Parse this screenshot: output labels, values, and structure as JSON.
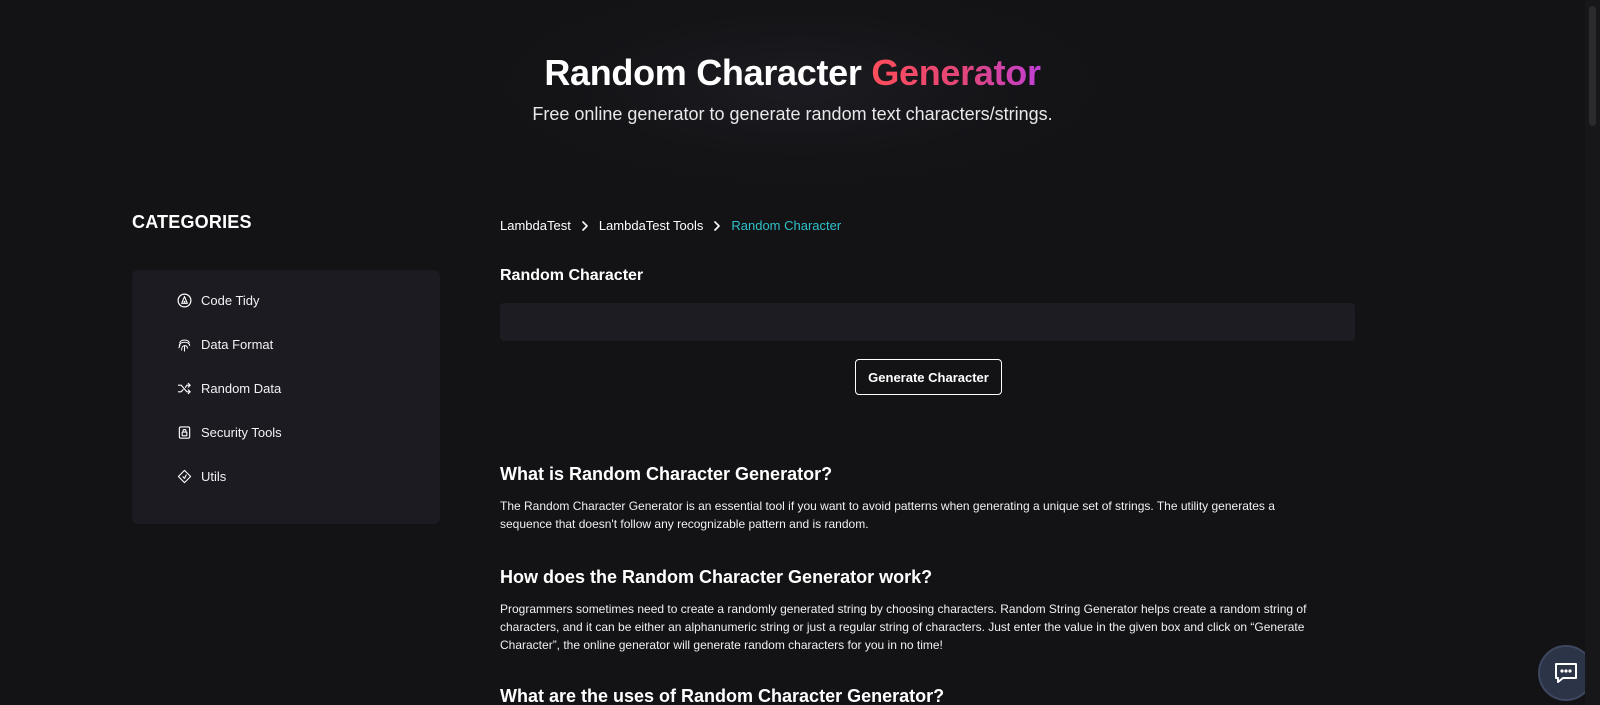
{
  "hero": {
    "title_main": "Random Character ",
    "title_accent": "Generator",
    "subtitle": "Free online generator to generate random text characters/strings."
  },
  "sidebar": {
    "heading": "CATEGORIES",
    "items": [
      {
        "label": "Code Tidy",
        "icon": "code-tidy-icon"
      },
      {
        "label": "Data Format",
        "icon": "fingerprint-icon"
      },
      {
        "label": "Random Data",
        "icon": "shuffle-icon"
      },
      {
        "label": "Security Tools",
        "icon": "lock-icon"
      },
      {
        "label": "Utils",
        "icon": "diamond-icon"
      }
    ]
  },
  "breadcrumb": {
    "items": [
      "LambdaTest",
      "LambdaTest Tools"
    ],
    "current": "Random Character"
  },
  "tool": {
    "label": "Random Character",
    "output_value": "",
    "button_label": "Generate Character"
  },
  "content": {
    "sections": [
      {
        "heading": "What is Random Character Generator?",
        "lines": [
          "The Random Character Generator is an essential tool if you want to avoid patterns when generating a unique set of strings. The utility generates a",
          "sequence that doesn't follow any recognizable pattern and is random."
        ]
      },
      {
        "heading": "How does the Random Character Generator work?",
        "lines": [
          "Programmers sometimes need to create a randomly generated string by choosing characters. Random String Generator helps create a random string of",
          "characters, and it can be either an alphanumeric string or just a regular string of characters. Just enter the value in the given box and click on “Generate",
          "Character”, the online generator will generate random characters for you in no time!"
        ]
      },
      {
        "heading": "What are the uses of Random Character Generator?",
        "lines": []
      }
    ]
  },
  "colors": {
    "background": "#131316",
    "panel": "#1b1b21",
    "accent_start": "#ff4d5a",
    "accent_end": "#c13fd6",
    "breadcrumb_current": "#2ec0c9",
    "chat_button": "#2c3447"
  },
  "chat": {
    "icon": "chat-icon"
  }
}
